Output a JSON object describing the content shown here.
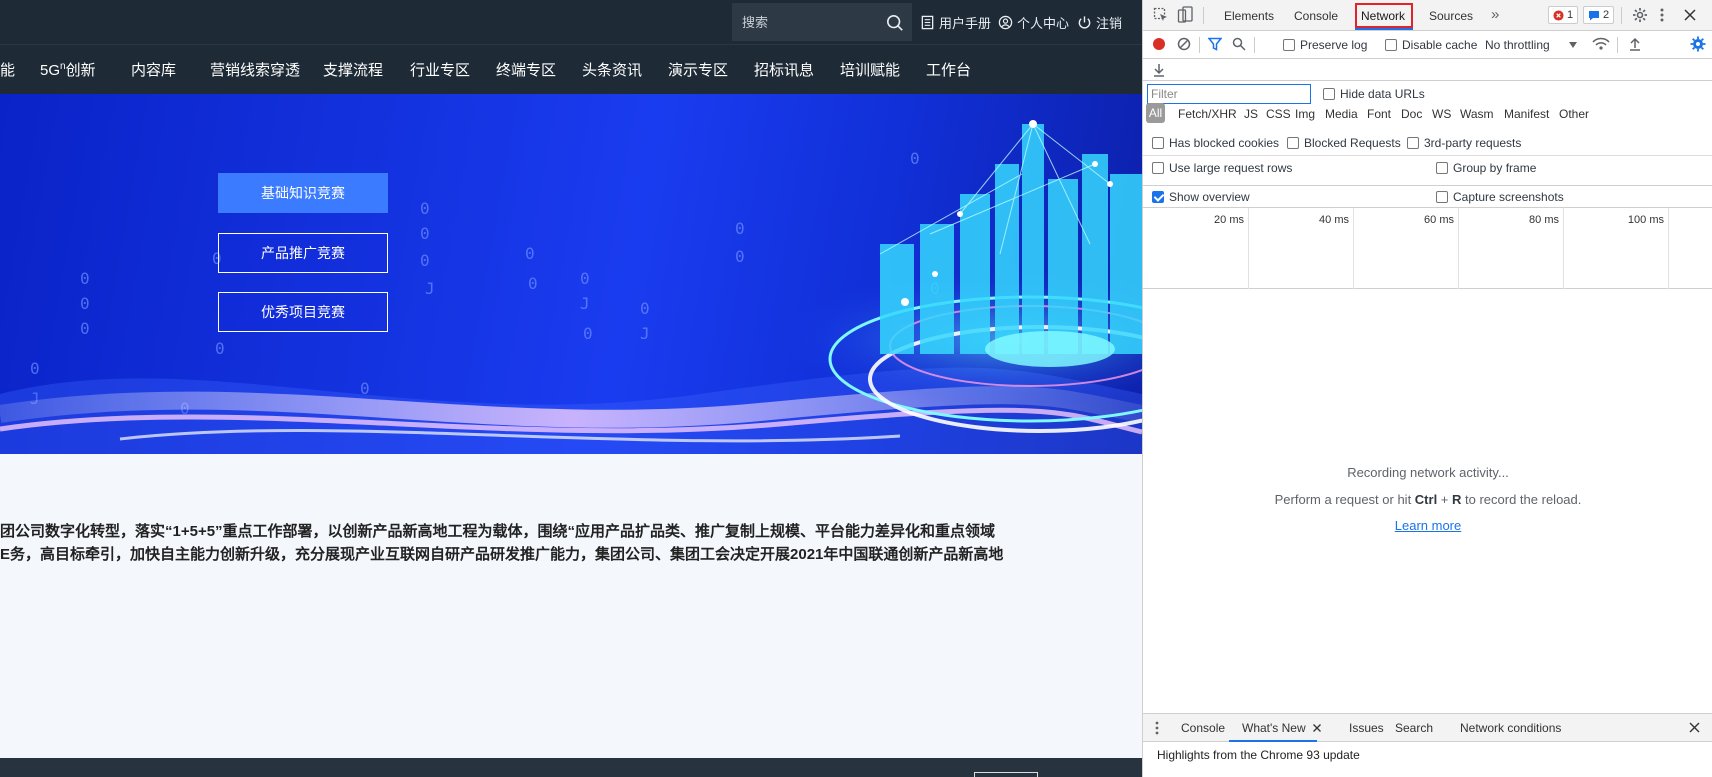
{
  "site": {
    "search_placeholder": "搜索",
    "top_links": {
      "manual": "用户手册",
      "profile": "个人中心",
      "logout": "注销"
    },
    "nav": [
      "能",
      "5G",
      "内容库",
      "营销线索穿透",
      "支撑流程",
      "行业专区",
      "终端专区",
      "头条资讯",
      "演示专区",
      "招标讯息",
      "培训赋能",
      "工作台"
    ],
    "nav_5g_sup": "n",
    "nav_5g_suffix": "创新",
    "banner_buttons": [
      "基础知识竞赛",
      "产品推广竞赛",
      "优秀项目竞赛"
    ],
    "intro_lines": [
      "团公司数字化转型，落实“1+5+5”重点工作部署，以创新产品新高地工程为载体，围绕“应用产品扩品类、推广复制上规模、平台能力差异化和重点领域",
      "E务，高目标牵引，加快自主能力创新升级，充分展现产业互联网自研产品研发推广能力，集团公司、集团工会决定开展2021年中国联通创新产品新高地"
    ]
  },
  "devtools": {
    "tabs": [
      "Elements",
      "Console",
      "Network",
      "Sources"
    ],
    "more_tabs": "»",
    "error_count": "1",
    "message_count": "2",
    "toolbar": {
      "preserve_log": "Preserve log",
      "disable_cache": "Disable cache",
      "throttling": "No throttling"
    },
    "filter": {
      "placeholder": "Filter",
      "hide_data_urls": "Hide data URLs",
      "types": [
        "All",
        "Fetch/XHR",
        "JS",
        "CSS",
        "Img",
        "Media",
        "Font",
        "Doc",
        "WS",
        "Wasm",
        "Manifest",
        "Other"
      ],
      "has_blocked_cookies": "Has blocked cookies",
      "blocked_requests": "Blocked Requests",
      "third_party": "3rd-party requests"
    },
    "options": {
      "large_rows": "Use large request rows",
      "group_by_frame": "Group by frame",
      "show_overview": "Show overview",
      "capture_screenshots": "Capture screenshots"
    },
    "overview_ticks": [
      "20 ms",
      "40 ms",
      "60 ms",
      "80 ms",
      "100 ms"
    ],
    "empty_state": {
      "recording": "Recording network activity...",
      "hint_prefix": "Perform a request or hit ",
      "hint_key1": "Ctrl",
      "hint_plus": " + ",
      "hint_key2": "R",
      "hint_suffix": " to record the reload.",
      "learn_more": "Learn more"
    },
    "drawer": {
      "tabs": [
        "Console",
        "What's New",
        "Issues",
        "Search",
        "Network conditions"
      ],
      "body": "Highlights from the Chrome 93 update"
    }
  }
}
